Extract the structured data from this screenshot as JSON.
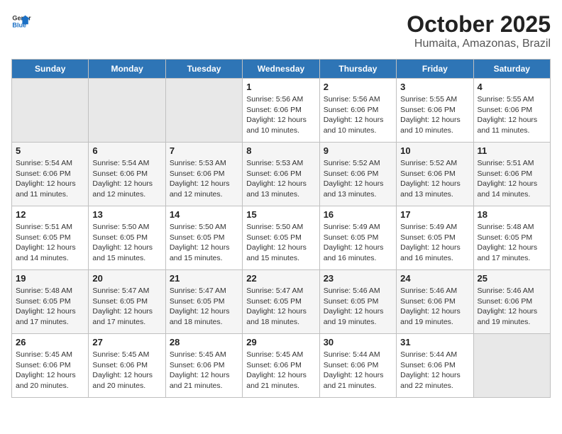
{
  "logo": {
    "text_general": "General",
    "text_blue": "Blue"
  },
  "header": {
    "month": "October 2025",
    "location": "Humaita, Amazonas, Brazil"
  },
  "weekdays": [
    "Sunday",
    "Monday",
    "Tuesday",
    "Wednesday",
    "Thursday",
    "Friday",
    "Saturday"
  ],
  "weeks": [
    [
      {
        "day": "",
        "sunrise": "",
        "sunset": "",
        "daylight": "",
        "empty": true
      },
      {
        "day": "",
        "sunrise": "",
        "sunset": "",
        "daylight": "",
        "empty": true
      },
      {
        "day": "",
        "sunrise": "",
        "sunset": "",
        "daylight": "",
        "empty": true
      },
      {
        "day": "1",
        "sunrise": "Sunrise: 5:56 AM",
        "sunset": "Sunset: 6:06 PM",
        "daylight": "Daylight: 12 hours and 10 minutes."
      },
      {
        "day": "2",
        "sunrise": "Sunrise: 5:56 AM",
        "sunset": "Sunset: 6:06 PM",
        "daylight": "Daylight: 12 hours and 10 minutes."
      },
      {
        "day": "3",
        "sunrise": "Sunrise: 5:55 AM",
        "sunset": "Sunset: 6:06 PM",
        "daylight": "Daylight: 12 hours and 10 minutes."
      },
      {
        "day": "4",
        "sunrise": "Sunrise: 5:55 AM",
        "sunset": "Sunset: 6:06 PM",
        "daylight": "Daylight: 12 hours and 11 minutes."
      }
    ],
    [
      {
        "day": "5",
        "sunrise": "Sunrise: 5:54 AM",
        "sunset": "Sunset: 6:06 PM",
        "daylight": "Daylight: 12 hours and 11 minutes."
      },
      {
        "day": "6",
        "sunrise": "Sunrise: 5:54 AM",
        "sunset": "Sunset: 6:06 PM",
        "daylight": "Daylight: 12 hours and 12 minutes."
      },
      {
        "day": "7",
        "sunrise": "Sunrise: 5:53 AM",
        "sunset": "Sunset: 6:06 PM",
        "daylight": "Daylight: 12 hours and 12 minutes."
      },
      {
        "day": "8",
        "sunrise": "Sunrise: 5:53 AM",
        "sunset": "Sunset: 6:06 PM",
        "daylight": "Daylight: 12 hours and 13 minutes."
      },
      {
        "day": "9",
        "sunrise": "Sunrise: 5:52 AM",
        "sunset": "Sunset: 6:06 PM",
        "daylight": "Daylight: 12 hours and 13 minutes."
      },
      {
        "day": "10",
        "sunrise": "Sunrise: 5:52 AM",
        "sunset": "Sunset: 6:06 PM",
        "daylight": "Daylight: 12 hours and 13 minutes."
      },
      {
        "day": "11",
        "sunrise": "Sunrise: 5:51 AM",
        "sunset": "Sunset: 6:06 PM",
        "daylight": "Daylight: 12 hours and 14 minutes."
      }
    ],
    [
      {
        "day": "12",
        "sunrise": "Sunrise: 5:51 AM",
        "sunset": "Sunset: 6:05 PM",
        "daylight": "Daylight: 12 hours and 14 minutes."
      },
      {
        "day": "13",
        "sunrise": "Sunrise: 5:50 AM",
        "sunset": "Sunset: 6:05 PM",
        "daylight": "Daylight: 12 hours and 15 minutes."
      },
      {
        "day": "14",
        "sunrise": "Sunrise: 5:50 AM",
        "sunset": "Sunset: 6:05 PM",
        "daylight": "Daylight: 12 hours and 15 minutes."
      },
      {
        "day": "15",
        "sunrise": "Sunrise: 5:50 AM",
        "sunset": "Sunset: 6:05 PM",
        "daylight": "Daylight: 12 hours and 15 minutes."
      },
      {
        "day": "16",
        "sunrise": "Sunrise: 5:49 AM",
        "sunset": "Sunset: 6:05 PM",
        "daylight": "Daylight: 12 hours and 16 minutes."
      },
      {
        "day": "17",
        "sunrise": "Sunrise: 5:49 AM",
        "sunset": "Sunset: 6:05 PM",
        "daylight": "Daylight: 12 hours and 16 minutes."
      },
      {
        "day": "18",
        "sunrise": "Sunrise: 5:48 AM",
        "sunset": "Sunset: 6:05 PM",
        "daylight": "Daylight: 12 hours and 17 minutes."
      }
    ],
    [
      {
        "day": "19",
        "sunrise": "Sunrise: 5:48 AM",
        "sunset": "Sunset: 6:05 PM",
        "daylight": "Daylight: 12 hours and 17 minutes."
      },
      {
        "day": "20",
        "sunrise": "Sunrise: 5:47 AM",
        "sunset": "Sunset: 6:05 PM",
        "daylight": "Daylight: 12 hours and 17 minutes."
      },
      {
        "day": "21",
        "sunrise": "Sunrise: 5:47 AM",
        "sunset": "Sunset: 6:05 PM",
        "daylight": "Daylight: 12 hours and 18 minutes."
      },
      {
        "day": "22",
        "sunrise": "Sunrise: 5:47 AM",
        "sunset": "Sunset: 6:05 PM",
        "daylight": "Daylight: 12 hours and 18 minutes."
      },
      {
        "day": "23",
        "sunrise": "Sunrise: 5:46 AM",
        "sunset": "Sunset: 6:05 PM",
        "daylight": "Daylight: 12 hours and 19 minutes."
      },
      {
        "day": "24",
        "sunrise": "Sunrise: 5:46 AM",
        "sunset": "Sunset: 6:06 PM",
        "daylight": "Daylight: 12 hours and 19 minutes."
      },
      {
        "day": "25",
        "sunrise": "Sunrise: 5:46 AM",
        "sunset": "Sunset: 6:06 PM",
        "daylight": "Daylight: 12 hours and 19 minutes."
      }
    ],
    [
      {
        "day": "26",
        "sunrise": "Sunrise: 5:45 AM",
        "sunset": "Sunset: 6:06 PM",
        "daylight": "Daylight: 12 hours and 20 minutes."
      },
      {
        "day": "27",
        "sunrise": "Sunrise: 5:45 AM",
        "sunset": "Sunset: 6:06 PM",
        "daylight": "Daylight: 12 hours and 20 minutes."
      },
      {
        "day": "28",
        "sunrise": "Sunrise: 5:45 AM",
        "sunset": "Sunset: 6:06 PM",
        "daylight": "Daylight: 12 hours and 21 minutes."
      },
      {
        "day": "29",
        "sunrise": "Sunrise: 5:45 AM",
        "sunset": "Sunset: 6:06 PM",
        "daylight": "Daylight: 12 hours and 21 minutes."
      },
      {
        "day": "30",
        "sunrise": "Sunrise: 5:44 AM",
        "sunset": "Sunset: 6:06 PM",
        "daylight": "Daylight: 12 hours and 21 minutes."
      },
      {
        "day": "31",
        "sunrise": "Sunrise: 5:44 AM",
        "sunset": "Sunset: 6:06 PM",
        "daylight": "Daylight: 12 hours and 22 minutes."
      },
      {
        "day": "",
        "sunrise": "",
        "sunset": "",
        "daylight": "",
        "empty": true
      }
    ]
  ]
}
